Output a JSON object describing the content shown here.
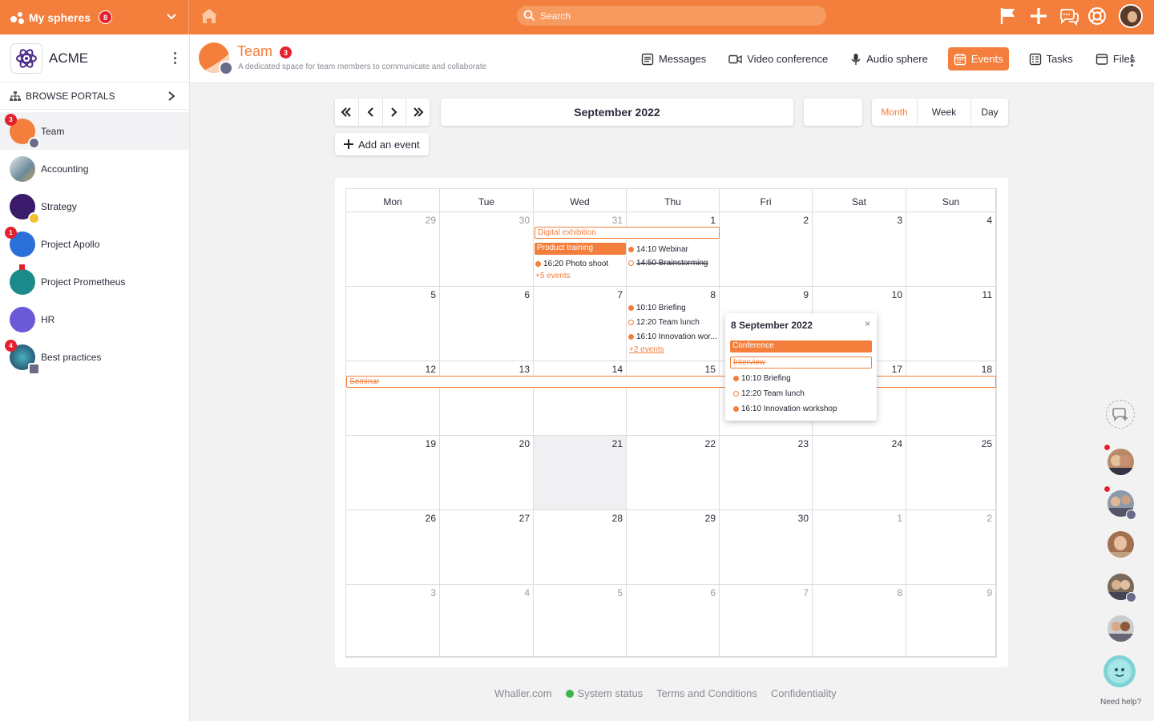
{
  "topbar": {
    "spheres_label": "My spheres",
    "spheres_badge": "8",
    "search_placeholder": "Search"
  },
  "sidebar": {
    "org_name": "ACME",
    "browse_label": "BROWSE PORTALS",
    "items": [
      {
        "label": "Team",
        "badge": "3"
      },
      {
        "label": "Accounting"
      },
      {
        "label": "Strategy"
      },
      {
        "label": "Project Apollo",
        "badge": "1"
      },
      {
        "label": "Project Prometheus"
      },
      {
        "label": "HR"
      },
      {
        "label": "Best practices",
        "badge": "4"
      }
    ]
  },
  "header": {
    "title": "Team",
    "badge": "3",
    "description": "A dedicated space for team members to communicate and collaborate",
    "tabs": [
      {
        "label": "Messages",
        "icon": "messages-icon"
      },
      {
        "label": "Video conference",
        "icon": "video-icon"
      },
      {
        "label": "Audio sphere",
        "icon": "microphone-icon"
      },
      {
        "label": "Events",
        "icon": "calendar-icon",
        "active": true
      },
      {
        "label": "Tasks",
        "icon": "tasks-icon"
      },
      {
        "label": "Files",
        "icon": "files-icon"
      }
    ]
  },
  "calendar": {
    "month_title": "September 2022",
    "add_event_label": "Add an event",
    "views": [
      "Month",
      "Week",
      "Day"
    ],
    "active_view": "Month",
    "weekdays": [
      "Mon",
      "Tue",
      "Wed",
      "Thu",
      "Fri",
      "Sat",
      "Sun"
    ],
    "weeks": [
      [
        "29",
        "30",
        "31",
        "1",
        "2",
        "3",
        "4"
      ],
      [
        "5",
        "6",
        "7",
        "8",
        "9",
        "10",
        "11"
      ],
      [
        "12",
        "13",
        "14",
        "15",
        "16",
        "17",
        "18"
      ],
      [
        "19",
        "20",
        "21",
        "22",
        "23",
        "24",
        "25"
      ],
      [
        "26",
        "27",
        "28",
        "29",
        "30",
        "1",
        "2"
      ],
      [
        "3",
        "4",
        "5",
        "6",
        "7",
        "8",
        "9"
      ]
    ],
    "events": {
      "digital_exhibition": "Digital exhibition",
      "product_training": "Product training",
      "photo_shoot": "16:20 Photo shoot",
      "more_w1": "+5 events",
      "webinar": "14:10 Webinar",
      "brainstorming": "14:50 Brainstorming",
      "briefing": "10:10 Briefing",
      "team_lunch": "12:20 Team lunch",
      "innovation": "16:10 Innovation wor...",
      "more_w2": "+2 events",
      "seminar": "Seminar"
    },
    "popover": {
      "title": "8 September 2022",
      "close": "×",
      "items": [
        "Conference",
        "Interview",
        "10:10 Briefing",
        "12:20 Team lunch",
        "16:10 Innovation workshop"
      ]
    }
  },
  "footer": {
    "links": [
      "Whaller.com",
      "System status",
      "Terms and Conditions",
      "Confidentiality"
    ]
  },
  "help": {
    "label": "Need help?"
  },
  "colors": {
    "accent": "#f47f3c",
    "badge": "#e5202e"
  }
}
